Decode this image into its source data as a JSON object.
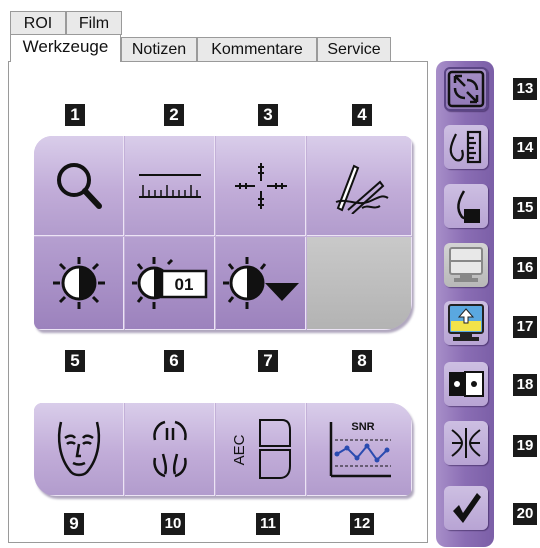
{
  "tabs_row1": [
    {
      "label": "ROI"
    },
    {
      "label": "Film"
    }
  ],
  "tabs_row2": [
    {
      "label": "Werkzeuge",
      "active": true
    },
    {
      "label": "Notizen"
    },
    {
      "label": "Kommentare"
    },
    {
      "label": "Service"
    }
  ],
  "tools_top": [
    {
      "num": "1",
      "icon": "magnifier-icon"
    },
    {
      "num": "2",
      "icon": "ruler-icon"
    },
    {
      "num": "3",
      "icon": "crosshair-icon"
    },
    {
      "num": "4",
      "icon": "annotation-pen-icon"
    },
    {
      "num": "5",
      "icon": "contrast-icon"
    },
    {
      "num": "6",
      "icon": "contrast-preset-icon",
      "badge": "01"
    },
    {
      "num": "7",
      "icon": "contrast-dropdown-icon"
    },
    {
      "num": "8",
      "icon": "empty-slot"
    }
  ],
  "tools_bottom": [
    {
      "num": "9",
      "icon": "face-icon"
    },
    {
      "num": "10",
      "icon": "mirror-compare-icon"
    },
    {
      "num": "11",
      "icon": "aec-icon",
      "text": "AEC"
    },
    {
      "num": "12",
      "icon": "snr-chart-icon",
      "text": "SNR"
    }
  ],
  "sidebar": [
    {
      "num": "13",
      "icon": "fit-view-icon"
    },
    {
      "num": "14",
      "icon": "measure-droplet-icon"
    },
    {
      "num": "15",
      "icon": "droplet-icon"
    },
    {
      "num": "16",
      "icon": "monitor-split-icon"
    },
    {
      "num": "17",
      "icon": "monitor-upload-icon"
    },
    {
      "num": "18",
      "icon": "dual-dot-icon"
    },
    {
      "num": "19",
      "icon": "converge-icon"
    },
    {
      "num": "20",
      "icon": "checkmark-icon"
    }
  ],
  "colors": {
    "tool_bg": "#c3b0d8",
    "sidebar_bg": "#8a6db4",
    "label_bg": "#1a1a1a"
  }
}
